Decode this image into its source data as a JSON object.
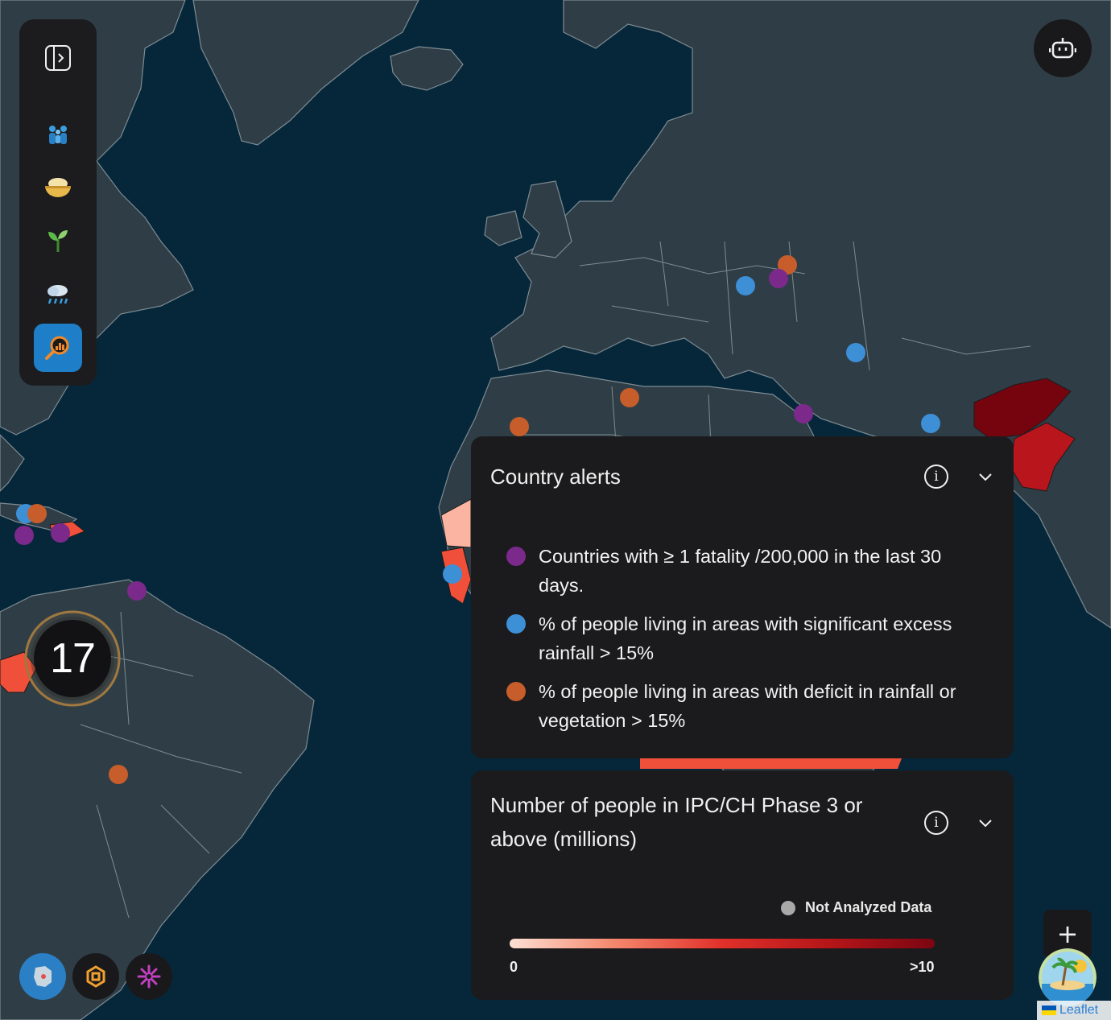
{
  "map": {
    "alert_colors": {
      "fatality": "#7b2a8c",
      "excess_rainfall": "#3d8fd6",
      "deficit_rainfall": "#c75d2a"
    },
    "ipc_colors": {
      "low": "#fbb4a1",
      "mid": "#f0503a",
      "high": "#b9151c",
      "very_high": "#76040f"
    }
  },
  "sidebar": {
    "items": [
      {
        "icon": "panel-toggle-icon"
      },
      {
        "icon": "people-icon"
      },
      {
        "icon": "food-bowl-icon"
      },
      {
        "icon": "sprout-icon"
      },
      {
        "icon": "rain-cloud-icon"
      },
      {
        "icon": "magnifier-chart-icon",
        "active": true
      }
    ]
  },
  "cluster": {
    "count": "17"
  },
  "alerts_panel": {
    "title": "Country alerts",
    "items": [
      {
        "color": "#7b2a8c",
        "text": "Countries with ≥ 1 fatality /200,000 in the last 30 days."
      },
      {
        "color": "#3d8fd6",
        "text": "% of people living in areas with significant excess rainfall > 15%"
      },
      {
        "color": "#c75d2a",
        "text": "% of people living in areas with deficit in rainfall or vegetation > 15%"
      }
    ]
  },
  "ipc_panel": {
    "title": "Number of people in IPC/CH Phase 3 or above (millions)",
    "not_analyzed": "Not Analyzed Data",
    "scale_min": "0",
    "scale_max": ">10"
  },
  "zoom": {
    "in_label": "+"
  },
  "attribution": {
    "label": "Leaflet"
  }
}
